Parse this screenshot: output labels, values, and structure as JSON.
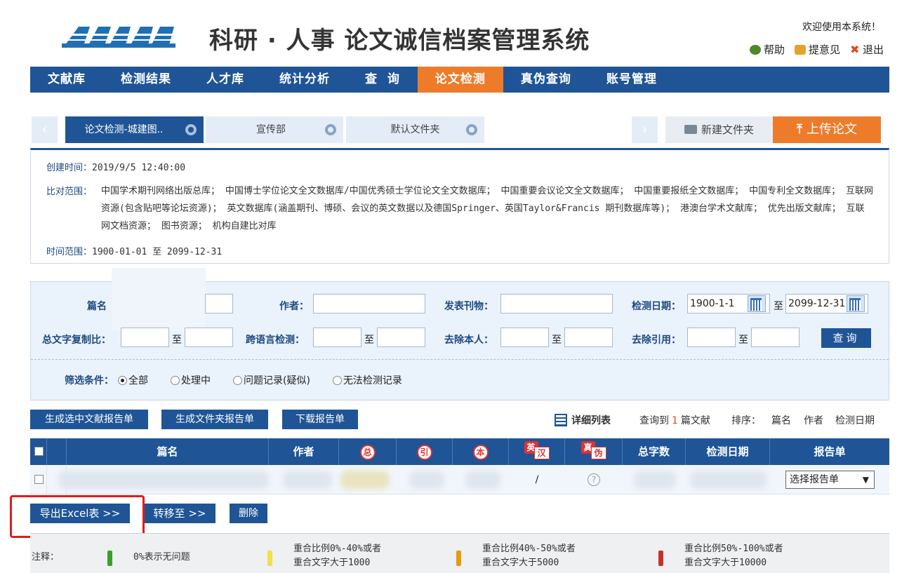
{
  "header": {
    "title": "科研 · 人事 论文诚信档案管理系统",
    "welcome": "欢迎使用本系统！",
    "links": {
      "help": "帮助",
      "feedback": "提意见",
      "logout": "退出"
    }
  },
  "nav": [
    "文献库",
    "检测结果",
    "人才库",
    "统计分析",
    "查  询",
    "论文检测",
    "真伪查询",
    "账号管理"
  ],
  "folders": {
    "prev": "‹",
    "next": "›",
    "tabs": [
      "论文检测-城建图..",
      "宣传部",
      "默认文件夹"
    ],
    "new_folder": "新建文件夹",
    "upload": "上传论文"
  },
  "info": {
    "created_label": "创建时间：",
    "created_value": "2019/9/5 12:40:00",
    "scope_label": "比对范围：",
    "scope_value": "中国学术期刊网络出版总库；  中国博士学位论文全文数据库/中国优秀硕士学位论文全文数据库；  中国重要会议论文全文数据库；  中国重要报纸全文数据库；  中国专利全文数据库；  互联网资源(包含贴吧等论坛资源)；  英文数据库(涵盖期刊、博硕、会议的英文数据以及德国Springer、英国Taylor&Francis 期刊数据库等)；  港澳台学术文献库；  优先出版文献库；  互联网文档资源；  图书资源；  机构自建比对库",
    "range_label": "时间范围：",
    "range_value": "1900-01-01 至 2099-12-31"
  },
  "search": {
    "title_label": "篇名",
    "author_label": "作者：",
    "journal_label": "发表刊物：",
    "date_label": "检测日期：",
    "date_from": "1900-1-1",
    "date_to": "2099-12-31",
    "ratio_label": "总文字复制比：",
    "cross_label": "跨语言检测：",
    "self_label": "去除本人：",
    "cite_label": "去除引用：",
    "to": "至",
    "query_btn": "查询",
    "filter_label": "筛选条件：",
    "filters": [
      "全部",
      "处理中",
      "问题记录(疑似)",
      "无法检测记录"
    ]
  },
  "actions": {
    "gen_selected": "生成选中文献报告单",
    "gen_folder": "生成文件夹报告单",
    "download": "下载报告单",
    "detail_list": "详细列表",
    "found_prefix": "查询到",
    "found_count": "1",
    "found_suffix": "篇文献",
    "sort_label": "排序：",
    "sort_title": "篇名",
    "sort_author": "作者",
    "sort_date": "检测日期"
  },
  "table": {
    "headers": {
      "title": "篇名",
      "author": "作者",
      "total": "总",
      "cite": "引",
      "self": "本",
      "en_a": "英",
      "en_b": "汉",
      "true_a": "真",
      "true_b": "伪",
      "words": "总字数",
      "date": "检测日期",
      "report": "报告单"
    },
    "row": {
      "en": "/",
      "true": "?",
      "report_select": "选择报告单"
    }
  },
  "bottom": {
    "export": "导出Excel表 >>",
    "move": "转移至 >>",
    "delete": "删除"
  },
  "legend": {
    "label": "注释：",
    "green": "0%表示无问题",
    "yellow_1": "重合比例0%-40%或者",
    "yellow_2": "重合文字大于1000",
    "orange_1": "重合比例40%-50%或者",
    "orange_2": "重合文字大于5000",
    "red_1": "重合比例50%-100%或者",
    "red_2": "重合文字大于10000"
  },
  "colors": {
    "primary": "#1f5596",
    "accent": "#ee7b2a",
    "highlight": "#e21b1b"
  }
}
